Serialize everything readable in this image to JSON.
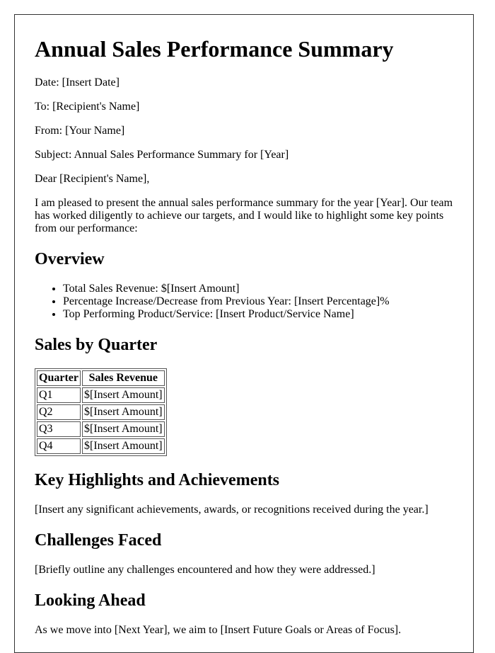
{
  "title": "Annual Sales Performance Summary",
  "meta": {
    "date": "Date: [Insert Date]",
    "to": "To: [Recipient's Name]",
    "from": "From: [Your Name]",
    "subject": "Subject: Annual Sales Performance Summary for [Year]"
  },
  "greeting": "Dear [Recipient's Name],",
  "intro": "I am pleased to present the annual sales performance summary for the year [Year]. Our team has worked diligently to achieve our targets, and I would like to highlight some key points from our performance:",
  "overview": {
    "heading": "Overview",
    "items": [
      "Total Sales Revenue: $[Insert Amount]",
      "Percentage Increase/Decrease from Previous Year: [Insert Percentage]%",
      "Top Performing Product/Service: [Insert Product/Service Name]"
    ]
  },
  "quarters": {
    "heading": "Sales by Quarter",
    "columns": [
      "Quarter",
      "Sales Revenue"
    ],
    "rows": [
      [
        "Q1",
        "$[Insert Amount]"
      ],
      [
        "Q2",
        "$[Insert Amount]"
      ],
      [
        "Q3",
        "$[Insert Amount]"
      ],
      [
        "Q4",
        "$[Insert Amount]"
      ]
    ]
  },
  "highlights": {
    "heading": "Key Highlights and Achievements",
    "text": "[Insert any significant achievements, awards, or recognitions received during the year.]"
  },
  "challenges": {
    "heading": "Challenges Faced",
    "text": "[Briefly outline any challenges encountered and how they were addressed.]"
  },
  "ahead": {
    "heading": "Looking Ahead",
    "text": "As we move into [Next Year], we aim to [Insert Future Goals or Areas of Focus]."
  }
}
